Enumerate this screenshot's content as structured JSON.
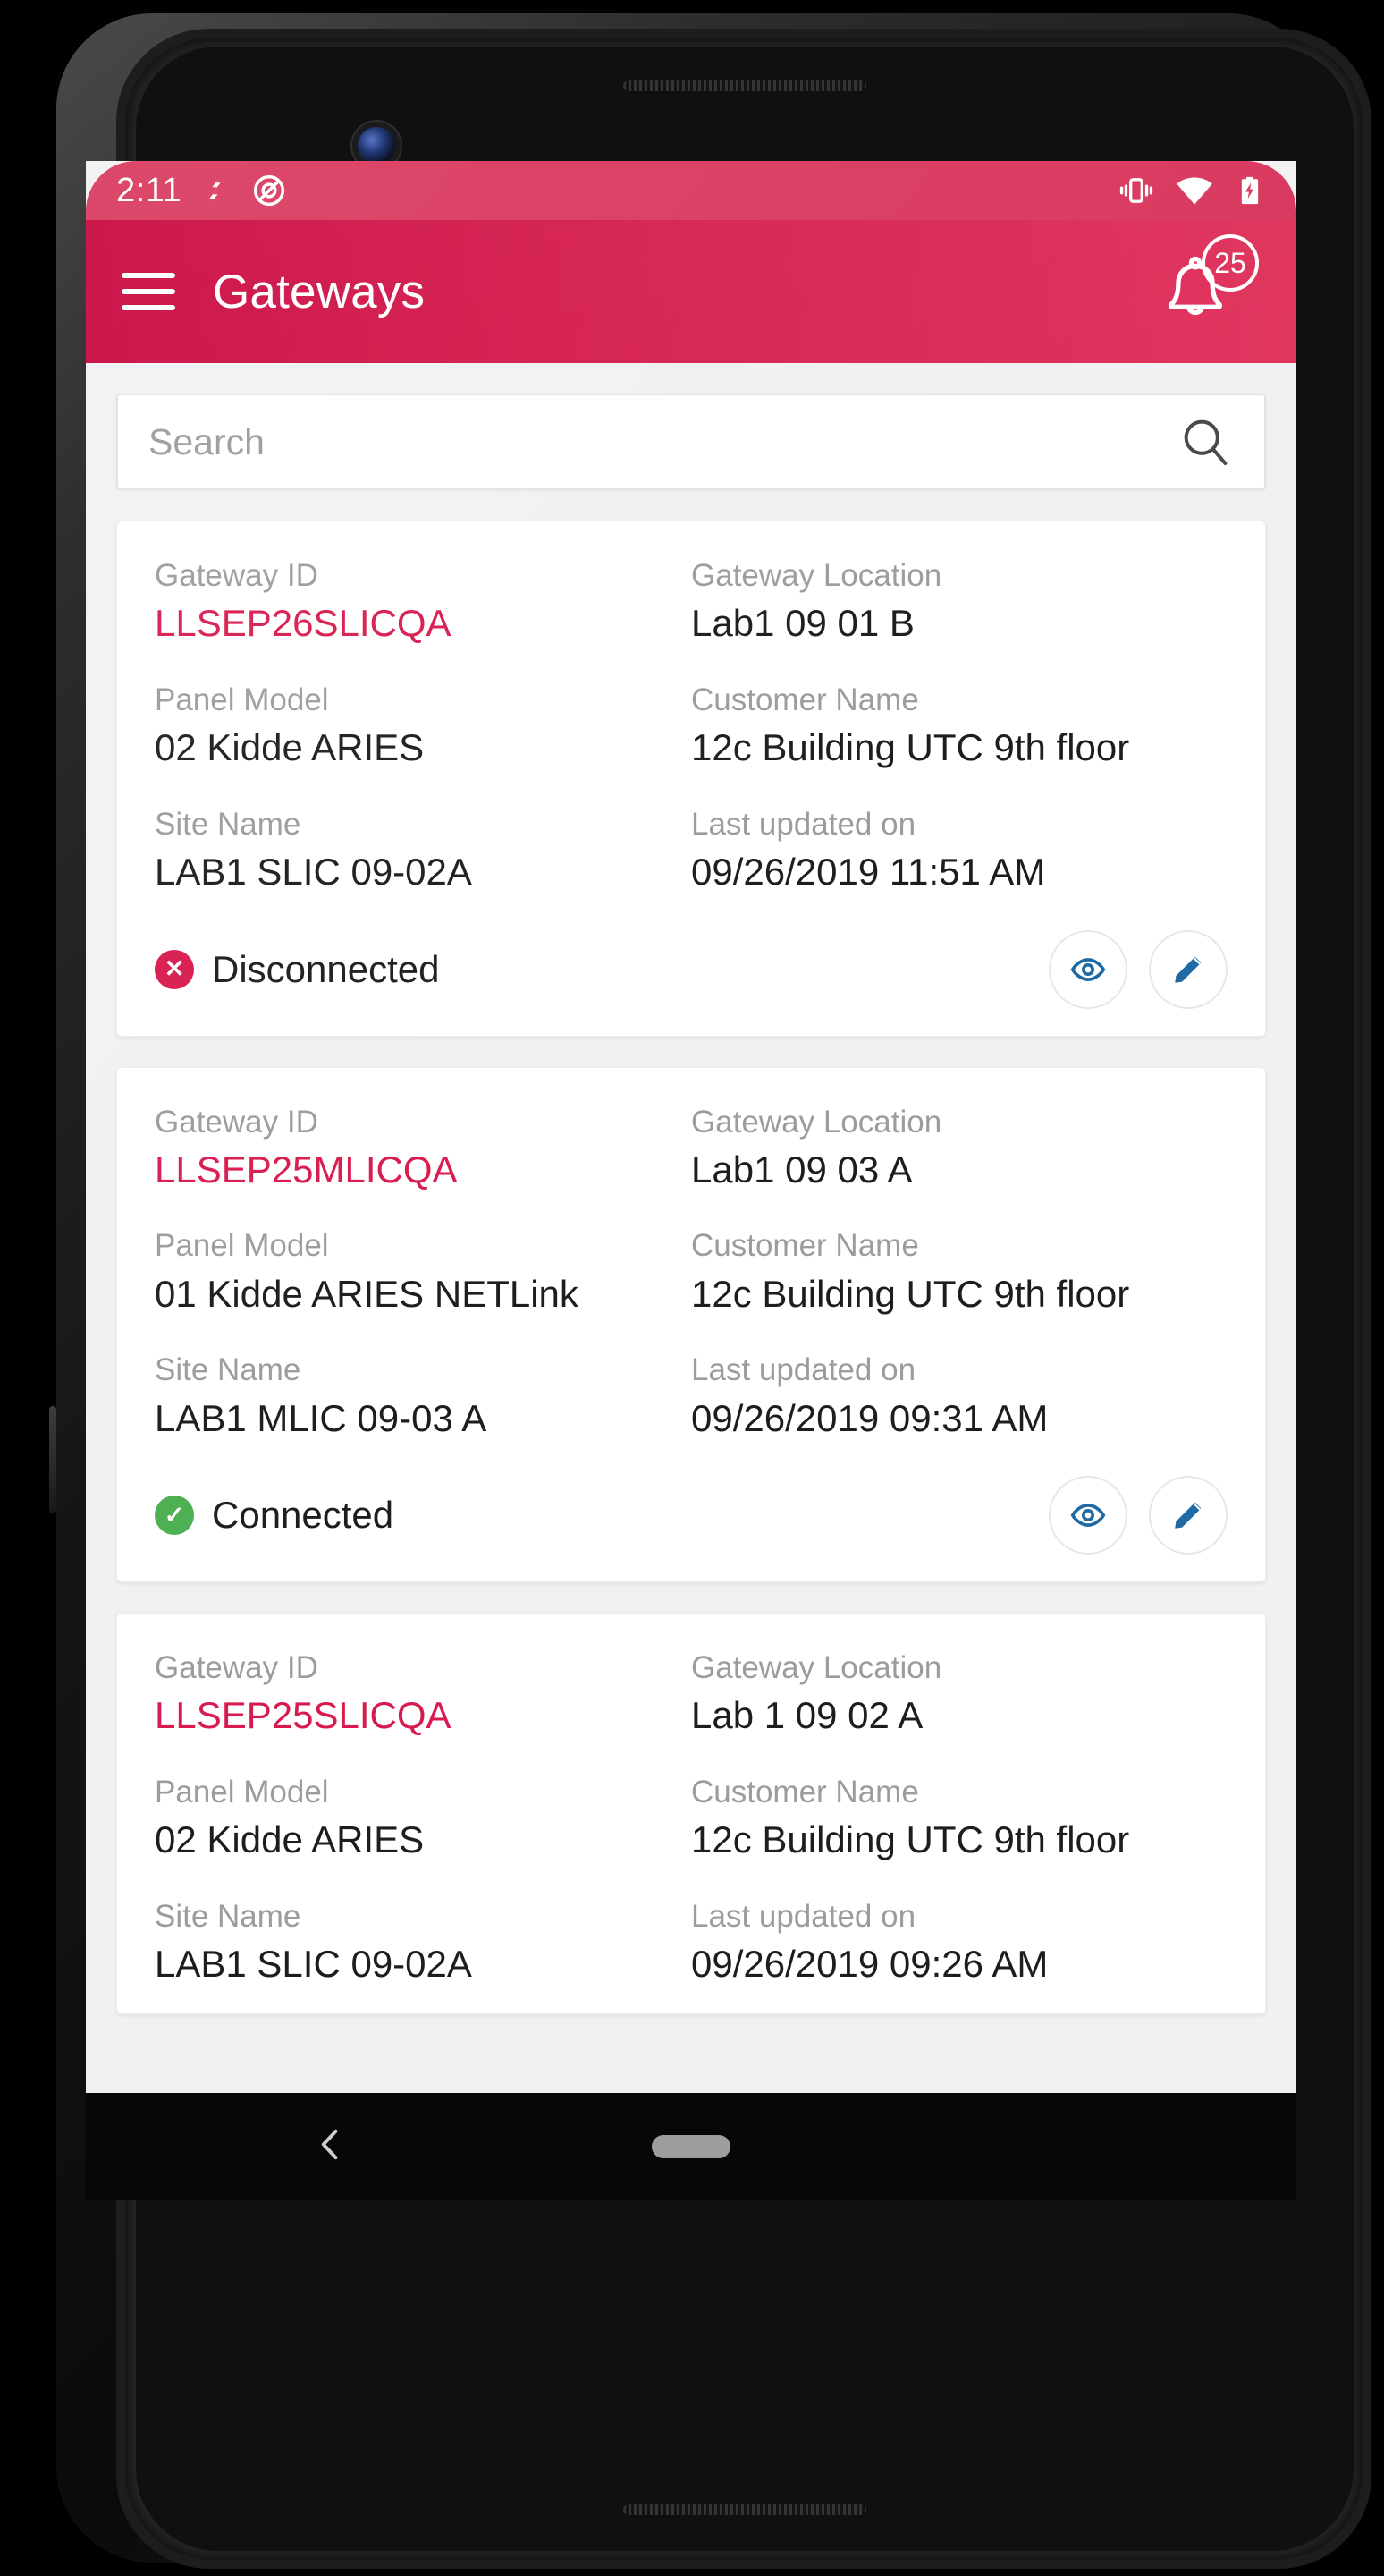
{
  "theme": {
    "primary": "#d31a4c",
    "primary_dark": "#c8073f",
    "accent_id": "#d81b4f",
    "action_blue": "#1f6aa5",
    "connected_green": "#4caf50",
    "disconnected_red": "#d81b4f"
  },
  "status_bar": {
    "time": "2:11",
    "icons_left": [
      "shutterstock-icon",
      "do-not-disturb-icon"
    ],
    "icons_right": [
      "vibrate-icon",
      "wifi-icon",
      "battery-charging-icon"
    ]
  },
  "app_bar": {
    "menu_icon": "hamburger-menu-icon",
    "title": "Gateways",
    "bell_icon": "notification-bell-icon",
    "badge_count": "25"
  },
  "search": {
    "placeholder": "Search",
    "value": "",
    "icon": "search-icon"
  },
  "card_labels": {
    "gateway_id": "Gateway ID",
    "gateway_location": "Gateway Location",
    "panel_model": "Panel Model",
    "customer_name": "Customer Name",
    "site_name": "Site Name",
    "last_updated": "Last updated on"
  },
  "actions": {
    "view_icon": "eye-icon",
    "edit_icon": "pencil-edit-icon"
  },
  "gateways": [
    {
      "gateway_id": "LLSEP26SLICQA",
      "gateway_location": "Lab1 09 01 B",
      "panel_model": "02 Kidde ARIES",
      "customer_name": "12c Building UTC 9th floor",
      "site_name": "LAB1 SLIC 09-02A",
      "last_updated": "09/26/2019 11:51 AM",
      "status": "Disconnected",
      "status_kind": "disconnected",
      "status_glyph": "✕"
    },
    {
      "gateway_id": "LLSEP25MLICQA",
      "gateway_location": "Lab1 09 03 A",
      "panel_model": "01 Kidde ARIES NETLink",
      "customer_name": "12c Building UTC 9th floor",
      "site_name": "LAB1 MLIC 09-03 A",
      "last_updated": "09/26/2019 09:31 AM",
      "status": "Connected",
      "status_kind": "connected",
      "status_glyph": "✓"
    },
    {
      "gateway_id": "LLSEP25SLICQA",
      "gateway_location": "Lab 1 09 02 A",
      "panel_model": "02 Kidde ARIES",
      "customer_name": "12c Building UTC 9th floor",
      "site_name": "LAB1 SLIC 09-02A",
      "last_updated": "09/26/2019 09:26 AM",
      "status": "",
      "status_kind": "",
      "status_glyph": ""
    }
  ],
  "nav_bar": {
    "back_icon": "back-chevron-icon",
    "home_pill": "home-pill-icon"
  }
}
